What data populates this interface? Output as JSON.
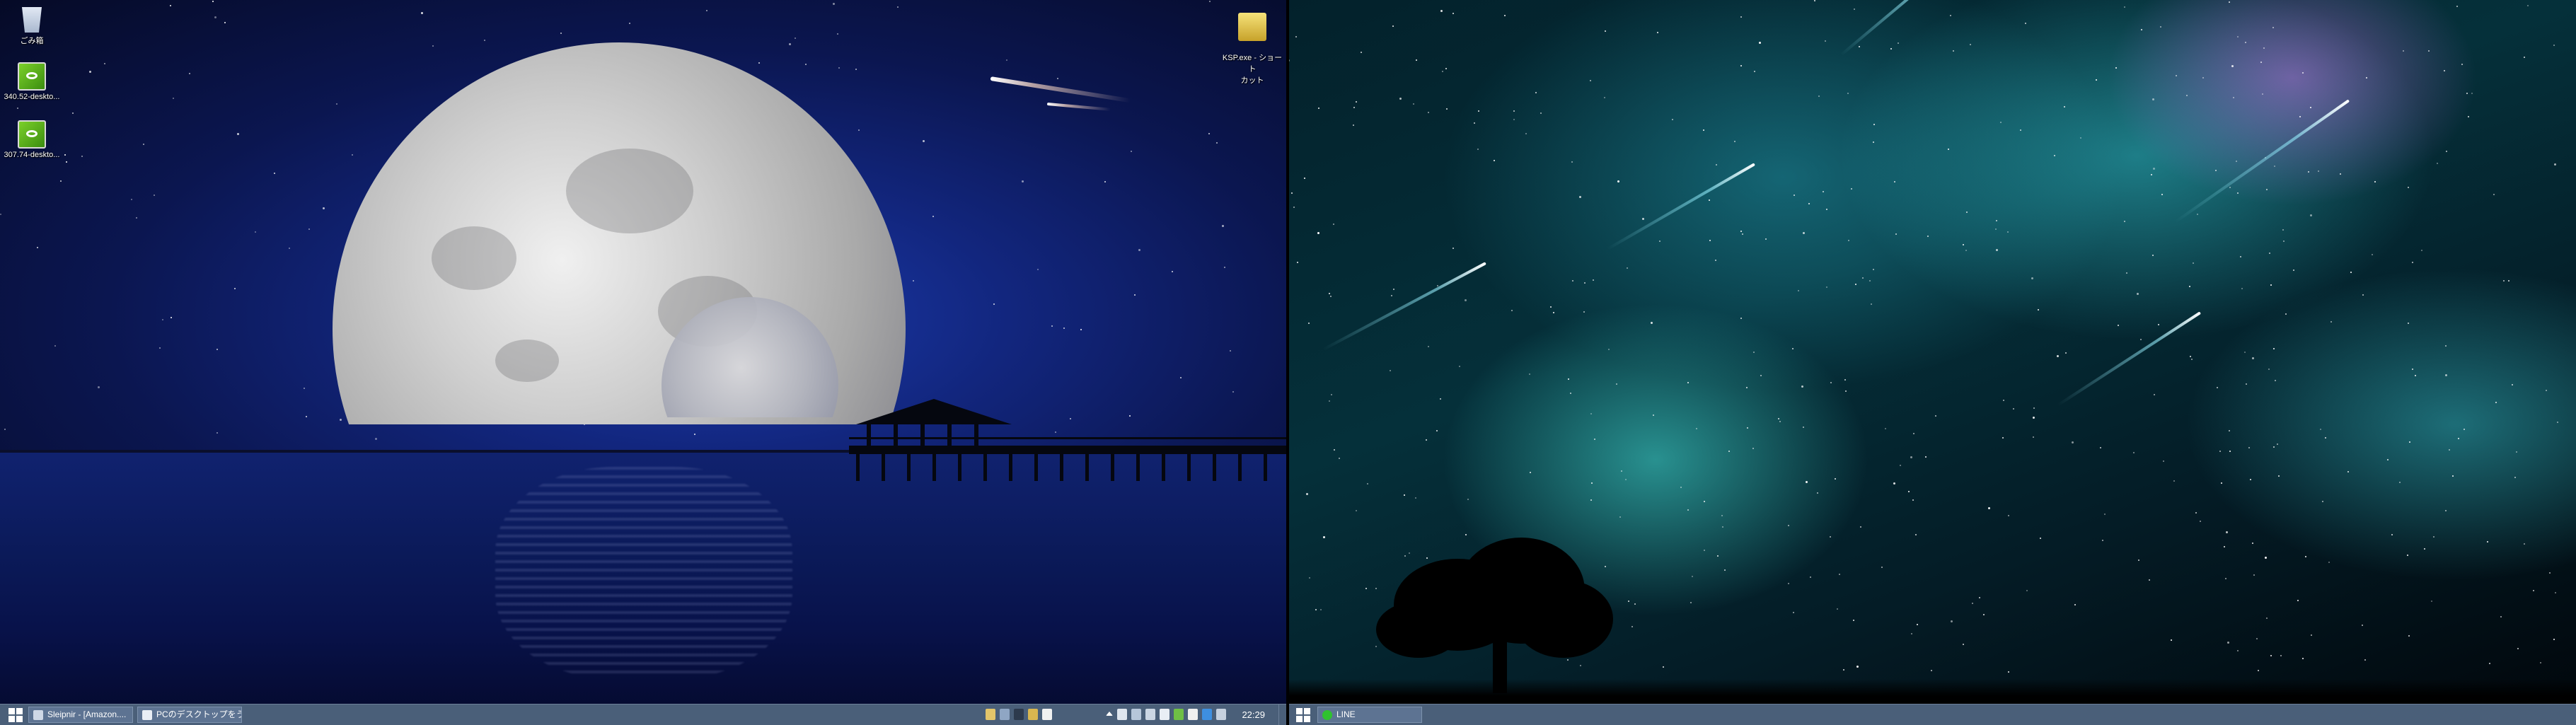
{
  "desktop_icons": [
    {
      "label": "ごみ箱",
      "icon": "recycle-bin-icon"
    },
    {
      "label": "340.52-deskto...",
      "icon": "nvidia-installer-icon"
    },
    {
      "label": "307.74-deskto...",
      "icon": "nvidia-installer-icon"
    },
    {
      "label": "KSP.exe - ショート\nカット",
      "icon": "ksp-shortcut-icon"
    }
  ],
  "taskbar_left": {
    "tasks": [
      {
        "label": "Sleipnir - [Amazon....",
        "icon": "sleipnir-browser-icon"
      },
      {
        "label": "PCのデスクトップをうp ...",
        "icon": "notepad-icon"
      }
    ],
    "clock": "22:29"
  },
  "taskbar_right": {
    "tasks": [
      {
        "label": "LINE",
        "icon": "line-app-icon"
      }
    ]
  },
  "colors": {
    "taskbar": "#4a5f79",
    "task_button": "#5d7392",
    "line_green": "#2fc22f"
  }
}
